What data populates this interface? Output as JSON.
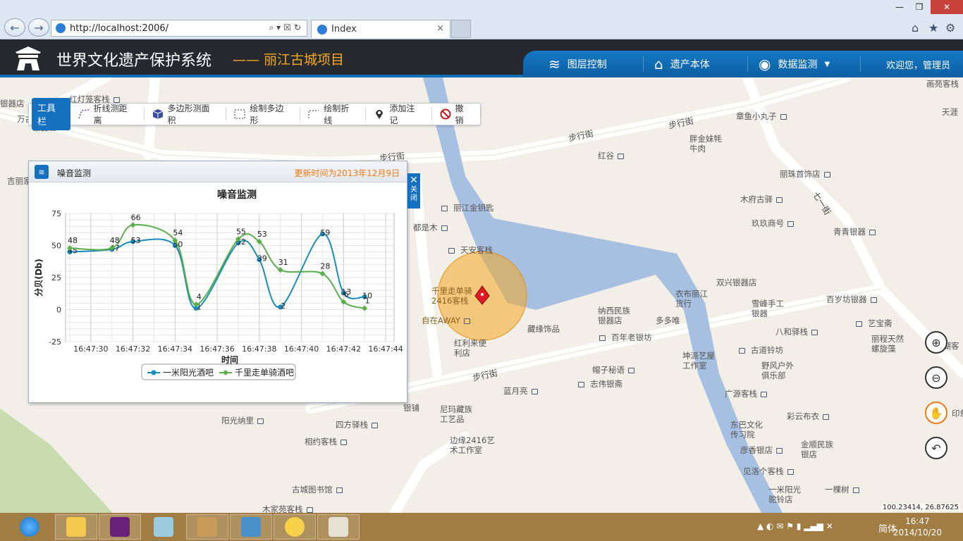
{
  "browser": {
    "url": "http://localhost:2006/",
    "tab_title": "Index",
    "tab_close": "×",
    "back": "←",
    "forward": "→",
    "addr_tools": "⌕▾☒↻",
    "win_min": "—",
    "win_max": "❐",
    "win_close": "✕",
    "home": "⌂",
    "fav": "★",
    "settings": "⚙"
  },
  "header": {
    "title": "世界文化遗产保护系统",
    "subtitle": "—— 丽江古城项目",
    "menu": [
      {
        "label": "图层控制",
        "icon": "layers-icon"
      },
      {
        "label": "遗产本体",
        "icon": "house-icon"
      },
      {
        "label": "数据监测",
        "icon": "monitor-icon",
        "dropdown": "▼"
      }
    ],
    "welcome": "欢迎您，管理员"
  },
  "toolbar": {
    "label": "工具栏",
    "buttons": [
      "折线测距离",
      "多边形测面积",
      "绘制多边形",
      "绘制折线",
      "添加注记",
      "撤销"
    ]
  },
  "panel": {
    "title": "噪音监测",
    "update": "更新时间为2013年12月9日",
    "close_label": "关闭",
    "close_x": "✕"
  },
  "chart_data": {
    "type": "line",
    "title": "噪音监测",
    "xlabel": "时间",
    "ylabel": "分贝(Db)",
    "ylim": [
      -25,
      75
    ],
    "yticks": [
      75,
      50,
      25,
      0,
      -25
    ],
    "x": [
      "16:47:29",
      "16:47:31",
      "16:47:32",
      "16:47:34",
      "16:47:35",
      "16:47:37",
      "16:47:38",
      "16:47:39",
      "16:47:41",
      "16:47:42",
      "16:47:43",
      "16:47:44"
    ],
    "xticks": [
      "16:47:30",
      "16:47:32",
      "16:47:34",
      "16:47:36",
      "16:47:38",
      "16:47:40",
      "16:47:42",
      "16:47:44"
    ],
    "series": [
      {
        "name": "一米阳光酒吧",
        "color": "#1b8bbd",
        "values": [
          45,
          47,
          53,
          50,
          1,
          52,
          39,
          2,
          59,
          13,
          10
        ]
      },
      {
        "name": "千里走单骑酒吧",
        "color": "#5bae4c",
        "values": [
          48,
          48,
          66,
          54,
          4,
          55,
          53,
          31,
          28,
          6,
          1
        ]
      }
    ]
  },
  "map": {
    "coords": "100.23414, 26.87625",
    "streets": [
      "步行街",
      "步行街",
      "步行街",
      "步行街",
      "七一街"
    ],
    "pois": [
      "红灯笼客栈",
      "银器店",
      "万古",
      "银器店",
      "吉丽家",
      "章鱼小丸子",
      "画苑客栈",
      "天涯",
      "红谷",
      "胖金妹牦牛肉",
      "丽珠首饰店",
      "木府古驿",
      "玖玖商号",
      "青青银器",
      "丽江金钥匙",
      "都是木",
      "天安客栈",
      "千里走单骑2416客栈",
      "自在AWAY",
      "红利来便利店",
      "双兴银器店",
      "衣布丽江货行",
      "雪峰手工银器",
      "百岁坊银器",
      "纳西民族银器店",
      "多多唯",
      "八和驿栈",
      "艺宝斋",
      "丽程天然螺旋藻",
      "藏缘饰品",
      "百年老银坊",
      "坤派艺屋工作室",
      "古道铃坊",
      "野风户外俱乐部",
      "帽子秘语",
      "志伟银斋",
      "蓝月亮",
      "广源客栈",
      "彩云布衣",
      "尼玛藏族工艺品",
      "银铺",
      "阳光纳里",
      "四方驿栈",
      "东巴文化传习院",
      "金顺民族银店",
      "相约客栈",
      "边缘2416艺术工作室",
      "彦香银店",
      "见洛个客栈",
      "古城图书馆",
      "一米阳光驼铃店",
      "一棵树",
      "木家苑客栈",
      "锦湖客",
      "印象"
    ]
  },
  "taskbar": {
    "time": "16:47",
    "date": "2014/10/20",
    "ime": "简体",
    "tray": "▲ ◐ ✉ ⚑ ▮ ▂▄▆ ✕"
  }
}
